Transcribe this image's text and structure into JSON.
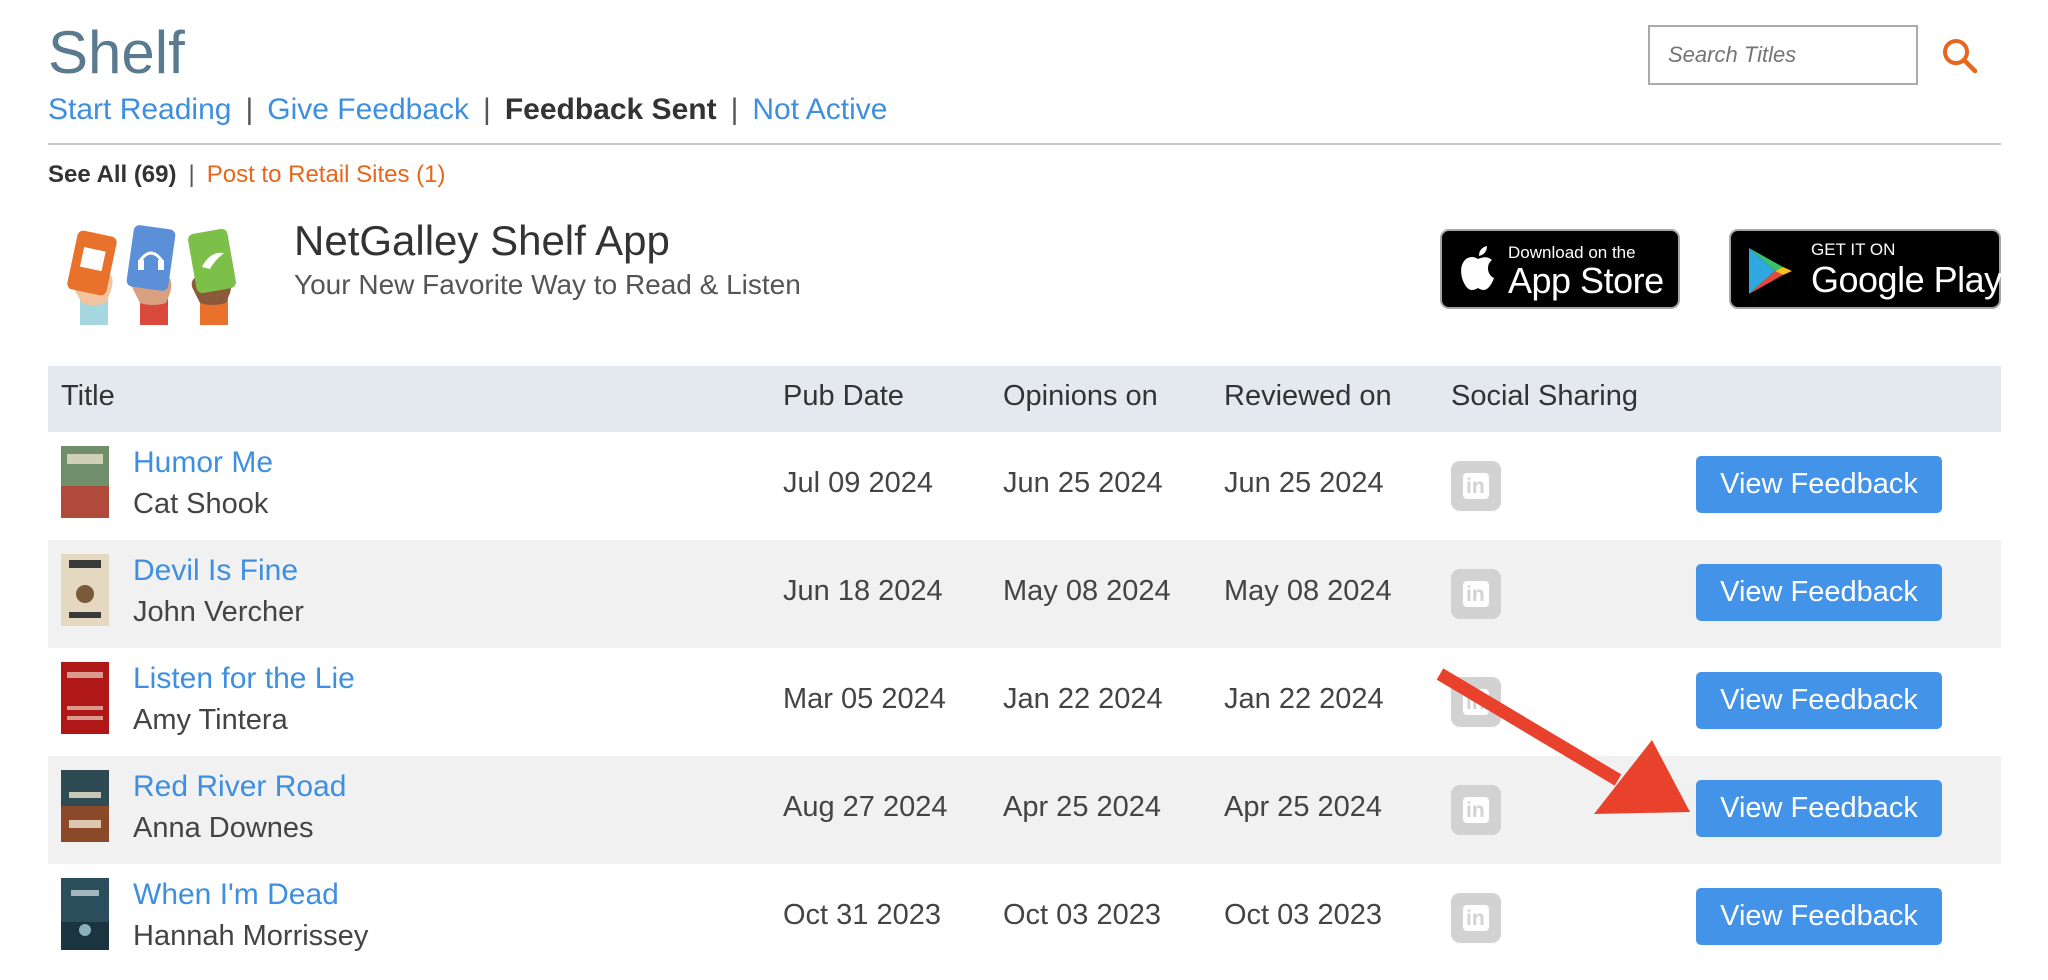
{
  "header": {
    "title": "Shelf",
    "nav": [
      {
        "label": "Start Reading",
        "active": false
      },
      {
        "label": "Give Feedback",
        "active": false
      },
      {
        "label": "Feedback Sent",
        "active": true
      },
      {
        "label": "Not Active",
        "active": false
      }
    ],
    "search": {
      "placeholder": "Search Titles",
      "icon": "search-icon"
    }
  },
  "subnav": {
    "see_all": "See All (69)",
    "post_retail": "Post to Retail Sites (1)"
  },
  "promo": {
    "title": "NetGalley Shelf App",
    "subtitle": "Your New Favorite Way to Read & Listen",
    "apple": {
      "small": "Download on the",
      "big": "App Store"
    },
    "google": {
      "small": "GET IT ON",
      "big": "Google Play"
    }
  },
  "table": {
    "headers": {
      "title": "Title",
      "pub_date": "Pub Date",
      "opinions": "Opinions on",
      "reviewed": "Reviewed on",
      "social": "Social Sharing"
    },
    "rows": [
      {
        "title": "Humor Me",
        "author": "Cat Shook",
        "pub_date": "Jul 09 2024",
        "opinions": "Jun 25 2024",
        "reviewed": "Jun 25 2024",
        "action": "View Feedback"
      },
      {
        "title": "Devil Is Fine",
        "author": "John Vercher",
        "pub_date": "Jun 18 2024",
        "opinions": "May 08 2024",
        "reviewed": "May 08 2024",
        "action": "View Feedback"
      },
      {
        "title": "Listen for the Lie",
        "author": "Amy Tintera",
        "pub_date": "Mar 05 2024",
        "opinions": "Jan 22 2024",
        "reviewed": "Jan 22 2024",
        "action": "View Feedback"
      },
      {
        "title": "Red River Road",
        "author": "Anna Downes",
        "pub_date": "Aug 27 2024",
        "opinions": "Apr 25 2024",
        "reviewed": "Apr 25 2024",
        "action": "View Feedback"
      },
      {
        "title": "When I'm Dead",
        "author": "Hannah Morrissey",
        "pub_date": "Oct 31 2023",
        "opinions": "Oct 03 2023",
        "reviewed": "Oct 03 2023",
        "action": "View Feedback"
      }
    ]
  },
  "colors": {
    "link": "#3f8fe0",
    "orange": "#e8661c",
    "button": "#4393e8",
    "arrow": "#e8412c",
    "header_bg": "#e4e9ef"
  }
}
